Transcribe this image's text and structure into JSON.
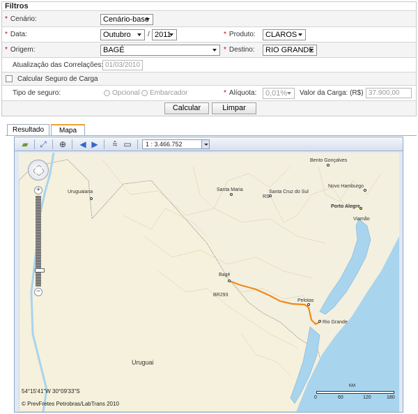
{
  "filters": {
    "title": "Filtros",
    "cenario": {
      "label": "Cenário:",
      "value": "Cenário-base"
    },
    "data": {
      "label": "Data:",
      "month": "Outubro",
      "sep": "/",
      "year": "2011"
    },
    "produto": {
      "label": "Produto:",
      "value": "CLAROS"
    },
    "origem": {
      "label": "Origem:",
      "value": "BAGÉ"
    },
    "destino": {
      "label": "Destino:",
      "value": "RIO GRANDE"
    },
    "atualizacao": {
      "label": "Atualização das Correlações:",
      "value": "01/03/2010"
    },
    "seguro": {
      "label": "Calcular Seguro de Carga"
    },
    "tipo_seguro": {
      "label": "Tipo de seguro:",
      "opcional": "Opcional",
      "embarcador": "Embarcador"
    },
    "aliquota": {
      "label": "Alíquota:",
      "value": "0,01%"
    },
    "valor_carga": {
      "label": "Valor da Carga: (R$)",
      "value": "37.900,00"
    },
    "buttons": {
      "calcular": "Calcular",
      "limpar": "Limpar"
    },
    "required_mark": "*"
  },
  "tabs": [
    {
      "label": "Resultado",
      "active": false
    },
    {
      "label": "Mapa",
      "active": true
    }
  ],
  "map": {
    "scale": "1 : 3.466.752",
    "coords": "54°15'41\"W 30°09'33\"S",
    "copyright": "© PrevFretes Petrobras/LabTrans 2010",
    "legend": {
      "unit": "KM",
      "ticks": [
        "0",
        "60",
        "120",
        "180"
      ]
    },
    "places": {
      "uruguaiana": "Uruguaiana",
      "santa_maria": "Santa Maria",
      "santa_cruz": "Santa Cruz do Sul",
      "rs": "RS",
      "bento": "Bento Gonçalves",
      "novo_hamburgo": "Novo Hamburgo",
      "porto_alegre": "Porto Alegre",
      "viamao": "Viamão",
      "bage": "Bagé",
      "br293": "BR293",
      "pelotas": "Pelotas",
      "rio_grande": "Rio Grande",
      "uruguai": "Uruguai"
    }
  },
  "colors": {
    "required": "#cc0000",
    "route": "#f08a1a",
    "water": "#a8d4ee",
    "land": "#f3f0e0",
    "tab_accent": "#f0a030"
  }
}
